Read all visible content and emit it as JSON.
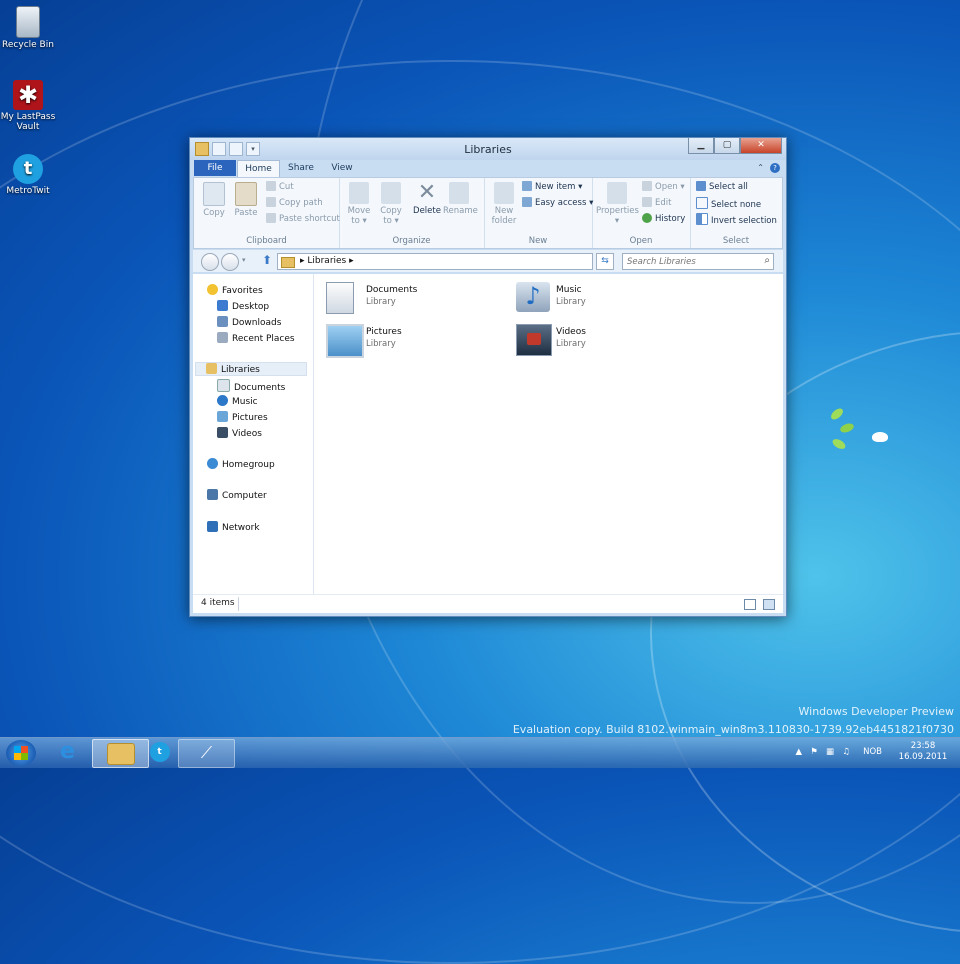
{
  "desktop": {
    "icons": [
      {
        "label": "Recycle Bin"
      },
      {
        "label": "My LastPass Vault"
      },
      {
        "label": "MetroTwit"
      }
    ],
    "watermark_line1": "Windows Developer Preview",
    "watermark_line2": "Evaluation copy. Build 8102.winmain_win8m3.110830-1739.92eb4451821f0730"
  },
  "window": {
    "title": "Libraries",
    "tabs": {
      "file": "File",
      "home": "Home",
      "share": "Share",
      "view": "View"
    },
    "help_glyph": "?",
    "ribbon": {
      "clipboard": {
        "label": "Clipboard",
        "copy": "Copy",
        "paste": "Paste",
        "cut": "Cut",
        "copy_path": "Copy path",
        "paste_shortcut": "Paste shortcut"
      },
      "organize": {
        "label": "Organize",
        "move_to": "Move",
        "move_to2": "to ▾",
        "copy_to": "Copy",
        "copy_to2": "to ▾",
        "delete": "Delete",
        "rename": "Rename"
      },
      "new": {
        "label": "New",
        "new_folder": "New",
        "new_folder2": "folder",
        "new_item": "New item ▾",
        "easy_access": "Easy access ▾"
      },
      "open": {
        "label": "Open",
        "properties": "Properties",
        "properties2": "▾",
        "open": "Open ▾",
        "edit": "Edit",
        "history": "History"
      },
      "select": {
        "label": "Select",
        "select_all": "Select all",
        "select_none": "Select none",
        "invert_selection": "Invert selection"
      }
    },
    "address": {
      "crumb": "▸ Libraries ▸",
      "search_placeholder": "Search Libraries"
    },
    "nav": {
      "favorites": "Favorites",
      "desktop": "Desktop",
      "downloads": "Downloads",
      "recent_places": "Recent Places",
      "libraries": "Libraries",
      "documents": "Documents",
      "music": "Music",
      "pictures": "Pictures",
      "videos": "Videos",
      "homegroup": "Homegroup",
      "computer": "Computer",
      "network": "Network"
    },
    "libraries": [
      {
        "name": "Documents",
        "type": "Library"
      },
      {
        "name": "Music",
        "type": "Library"
      },
      {
        "name": "Pictures",
        "type": "Library"
      },
      {
        "name": "Videos",
        "type": "Library"
      }
    ],
    "status": {
      "count": "4 items"
    }
  },
  "taskbar": {
    "language": "NOB",
    "time": "23:58",
    "date": "16.09.2011"
  },
  "colors": {
    "accent": "#2a64bd",
    "window_frame": "#c8ddf2",
    "close": "#c8432a"
  }
}
